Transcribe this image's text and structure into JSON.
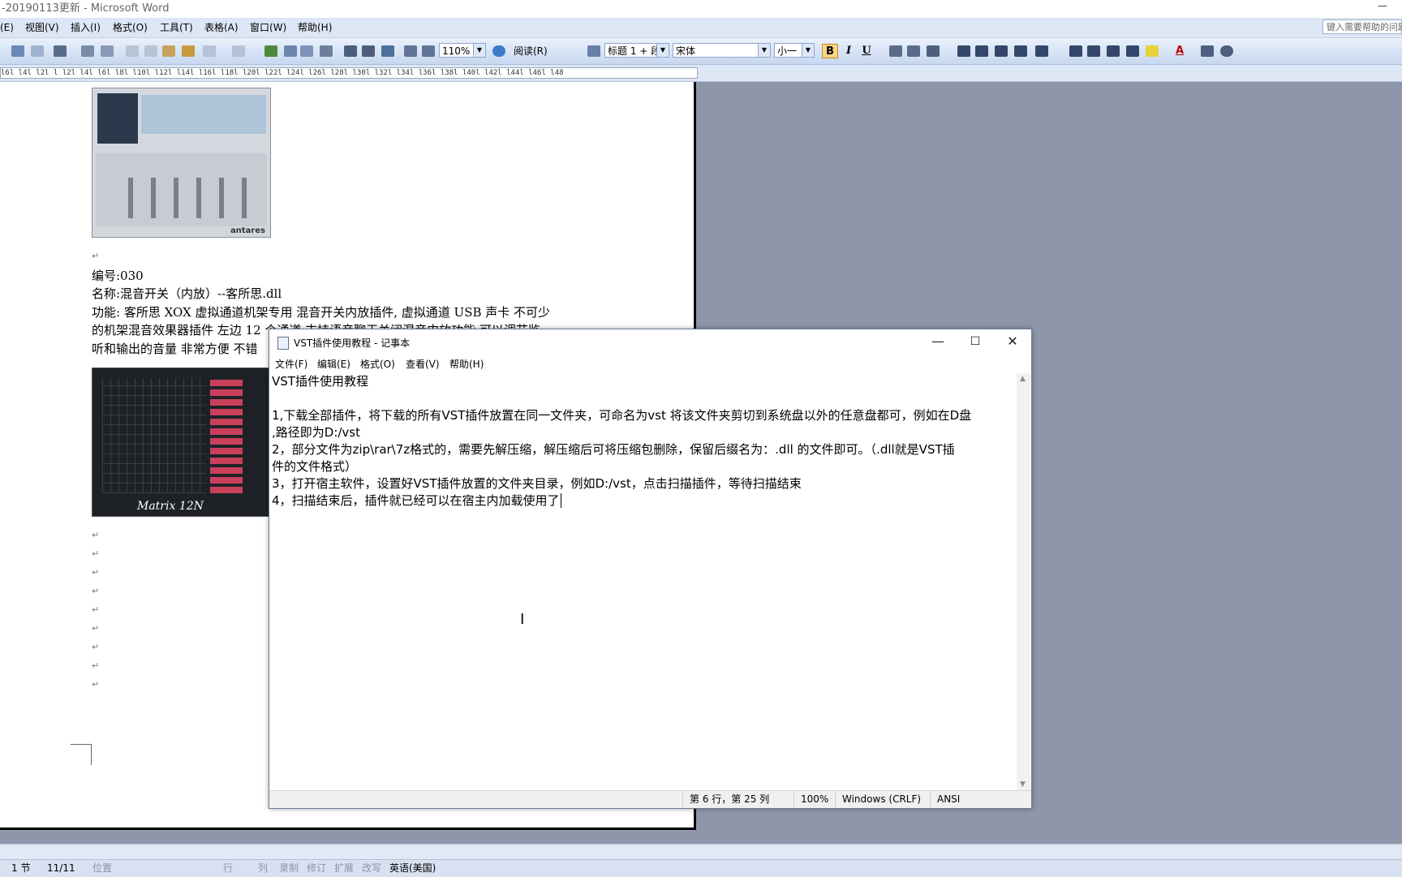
{
  "word": {
    "title": "-20190113更新 - Microsoft Word",
    "minimize": "—",
    "menus": [
      "(E)",
      "视图(V)",
      "插入(I)",
      "格式(O)",
      "工具(T)",
      "表格(A)",
      "窗口(W)",
      "帮助(H)"
    ],
    "help_placeholder": "键入需要帮助的问题",
    "toolbar": {
      "zoom": "110%",
      "read_mode": "阅读(R)",
      "style": "标题 1 + 段",
      "font": "宋体",
      "size": "小一",
      "bold": "B",
      "italic": "I",
      "underline": "U",
      "font_color_letter": "A"
    },
    "ruler_text": "l6l l4l l2l l l2l l4l l6l l8l l10l l12l l14l l16l l18l l20l l22l l24l l26l l28l l30l l32l l34l l36l l38l l40l l42l l44l l46l l48",
    "doc": {
      "line_number": "编号:030",
      "line_name": "名称:混音开关（内放）--客所思.dll",
      "line_func1": "功能: 客所思 XOX 虚拟通道机架专用  混音开关内放插件, 虚拟通道 USB 声卡  不可少",
      "line_func2": "的机架混音效果器插件  左边 12 个通道 支持语音聊天关闭混音内放功能 可以调节监",
      "line_func3": "听和输出的音量  非常方便  不错",
      "para_mark": "↵",
      "image1_brand": "antares",
      "image2_label": "Matrix 12N"
    },
    "status": {
      "section": "1 节",
      "page": "11/11",
      "position": "位置",
      "line": "行",
      "column": "列",
      "rec": "录制",
      "trk": "修订",
      "ext": "扩展",
      "ovr": "改写",
      "language": "英语(美国)"
    }
  },
  "notepad": {
    "title": "VST插件使用教程 - 记事本",
    "controls": {
      "minimize": "—",
      "maximize": "☐",
      "close": "✕"
    },
    "menus": [
      "文件(F)",
      "编辑(E)",
      "格式(O)",
      "查看(V)",
      "帮助(H)"
    ],
    "lines": [
      "VST插件使用教程",
      "",
      "1,下载全部插件，将下载的所有VST插件放置在同一文件夹，可命名为vst 将该文件夹剪切到系统盘以外的任意盘都可，例如在D盘",
      ",路径即为D:/vst",
      "2，部分文件为zip\\rar\\7z格式的，需要先解压缩，解压缩后可将压缩包删除，保留后缀名为：.dll 的文件即可。（.dll就是VST插",
      "件的文件格式）",
      "3，打开宿主软件，设置好VST插件放置的文件夹目录，例如D:/vst，点击扫描插件，等待扫描结束",
      "4，扫描结束后，插件就已经可以在宿主内加载使用了"
    ],
    "status": {
      "position": "第 6 行，第 25 列",
      "zoom": "100%",
      "line_ending": "Windows (CRLF)",
      "encoding": "ANSI"
    }
  },
  "colors": {
    "desktop": "#8e97aa",
    "word_menubar": "#dde6f5",
    "toolbar_gradient_top": "#eaf1fb",
    "toolbar_gradient_bottom": "#c7d7f0"
  }
}
